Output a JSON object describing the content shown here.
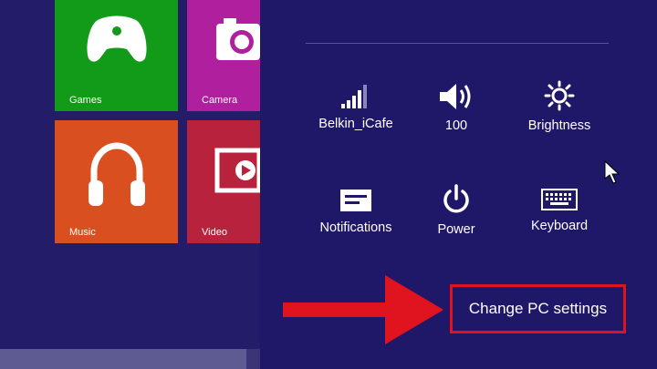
{
  "start": {
    "tiles": [
      {
        "label": "Games",
        "color": "#119b19",
        "icon": "game-controller-icon"
      },
      {
        "label": "Camera",
        "color": "#b01f9d",
        "icon": "camera-icon"
      },
      {
        "label": "Music",
        "color": "#d94f1f",
        "icon": "headphones-icon"
      },
      {
        "label": "Video",
        "color": "#b9223d",
        "icon": "video-play-icon"
      }
    ]
  },
  "charm": {
    "quick_settings": [
      {
        "label": "Belkin_iCafe",
        "icon": "wifi-signal-icon"
      },
      {
        "label": "100",
        "icon": "volume-icon"
      },
      {
        "label": "Brightness",
        "icon": "brightness-icon"
      },
      {
        "label": "Notifications",
        "icon": "notifications-icon"
      },
      {
        "label": "Power",
        "icon": "power-icon"
      },
      {
        "label": "Keyboard",
        "icon": "keyboard-icon"
      }
    ],
    "change_pc_settings": "Change PC settings"
  },
  "annotation": {
    "arrow_color": "#e0141e",
    "highlight_color": "#e0141e"
  }
}
